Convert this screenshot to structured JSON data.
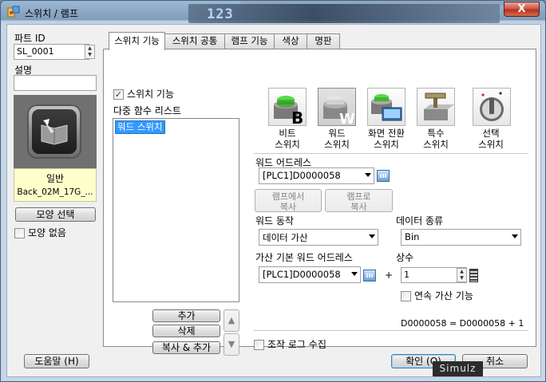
{
  "window": {
    "title": "스위치 / 램프",
    "close_label": "X"
  },
  "background": {
    "number": "123"
  },
  "left": {
    "part_id_label": "파트 ID",
    "part_id_value": "SL_0001",
    "description_label": "설명",
    "description_value": "",
    "shape_name": "일반",
    "shape_file": "Back_02M_17G_...",
    "select_shape_button": "모양 선택",
    "no_shape_label": "모양 없음",
    "no_shape_checked": false
  },
  "tabs": [
    {
      "label": "스위치 기능",
      "active": true
    },
    {
      "label": "스위치 공통",
      "active": false
    },
    {
      "label": "램프 기능",
      "active": false
    },
    {
      "label": "색상",
      "active": false
    },
    {
      "label": "명판",
      "active": false
    }
  ],
  "switch_panel": {
    "switch_function_label": "스위치 기능",
    "switch_function_checked": true,
    "multi_function_list_label": "다중 함수 리스트",
    "list_items": [
      "워드 스위치"
    ],
    "selected_index": 0,
    "add_button": "추가",
    "delete_button": "삭제",
    "copy_add_button": "복사 & 추가",
    "switch_types": [
      {
        "line1": "비트",
        "line2": "스위치",
        "icon": "bit-switch-icon"
      },
      {
        "line1": "워드",
        "line2": "스위치",
        "icon": "word-switch-icon",
        "selected": true
      },
      {
        "line1": "화면 전환",
        "line2": "스위치",
        "icon": "screen-change-switch-icon"
      },
      {
        "line1": "특수",
        "line2": "스위치",
        "icon": "special-switch-icon"
      },
      {
        "line1": "선택",
        "line2": "스위치",
        "icon": "selector-switch-icon"
      }
    ],
    "word_address_label": "워드 어드레스",
    "word_address_value": "[PLC1]D0000058",
    "copy_from_lamp_line1": "램프에서",
    "copy_from_lamp_line2": "복사",
    "copy_to_lamp_line1": "램프로",
    "copy_to_lamp_line2": "복사",
    "word_action_label": "워드 동작",
    "word_action_value": "데이터 가산",
    "data_type_label": "데이터 종류",
    "data_type_value": "Bin",
    "add_base_address_label": "가산 기본 워드 어드레스",
    "add_base_address_value": "[PLC1]D0000058",
    "plus_sign": "+",
    "constant_label": "상수",
    "constant_value": "1",
    "continuous_add_label": "연속 가산 기능",
    "continuous_add_checked": false,
    "formula": "D0000058 = D0000058 + 1",
    "operation_log_label": "조작 로그 수집",
    "operation_log_checked": false
  },
  "footer": {
    "help_button": "도움말 (H)",
    "ok_button": "확인 (O)",
    "cancel_button": "취소",
    "watermark": "Simulz"
  },
  "colors": {
    "selection": "#3399ff",
    "title_bar": "#8aa7c6"
  }
}
